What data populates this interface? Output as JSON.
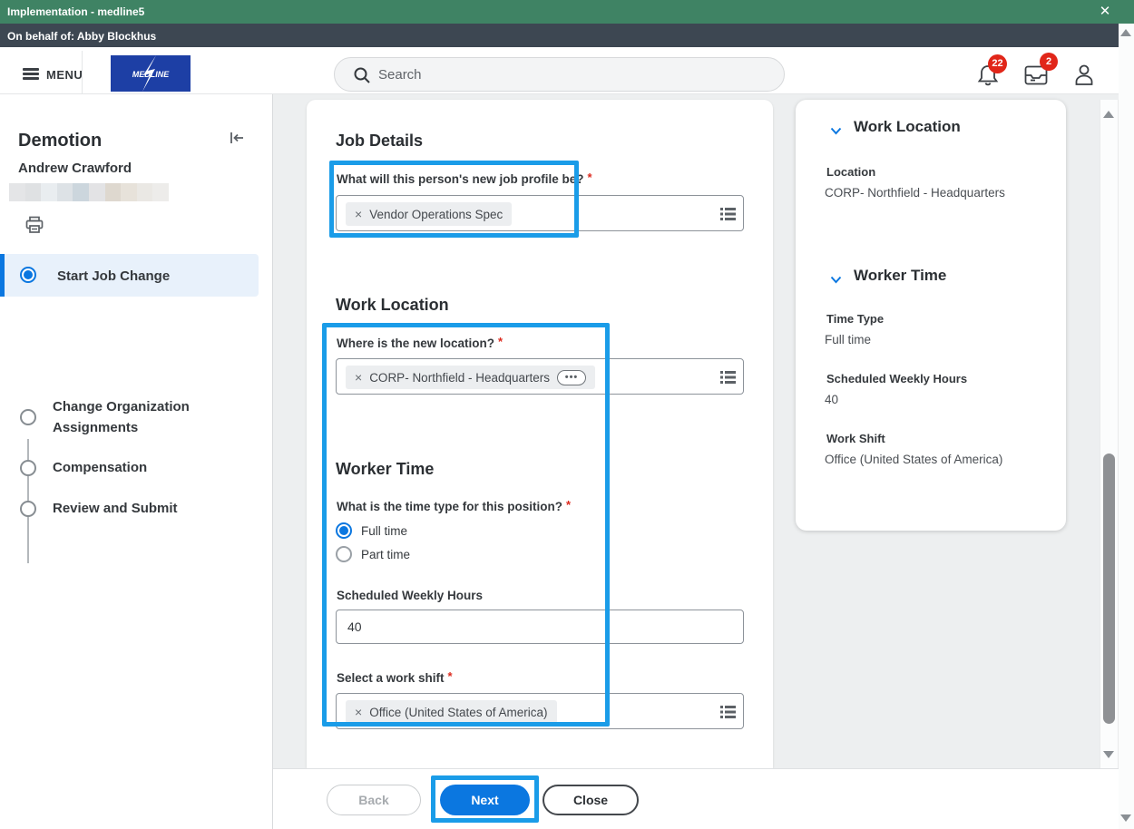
{
  "banner": {
    "title": "Implementation - medline5"
  },
  "proxy_bar": {
    "text": "On behalf of: Abby Blockhus"
  },
  "header": {
    "menu_label": "MENU",
    "logo_text": "MEDLINE",
    "search_placeholder": "Search",
    "notifications_badge": "22",
    "inbox_badge": "2"
  },
  "sidebar": {
    "title": "Demotion",
    "person_name": "Andrew Crawford",
    "steps": [
      {
        "label": "Start Job Change",
        "state": "current"
      },
      {
        "label": "Change Organization Assignments",
        "state": "upcoming"
      },
      {
        "label": "Compensation",
        "state": "upcoming"
      },
      {
        "label": "Review and Submit",
        "state": "upcoming"
      }
    ]
  },
  "form": {
    "required_marker": "*",
    "job_details": {
      "heading": "Job Details",
      "profile_question": "What will this person's new job profile be?",
      "profile_value": "Vendor Operations Spec"
    },
    "work_location": {
      "heading": "Work Location",
      "location_question": "Where is the new location?",
      "location_value": "CORP- Northfield - Headquarters"
    },
    "worker_time": {
      "heading": "Worker Time",
      "time_type_question": "What is the time type for this position?",
      "options": [
        {
          "label": "Full time",
          "selected": true
        },
        {
          "label": "Part time",
          "selected": false
        }
      ],
      "hours_label": "Scheduled Weekly Hours",
      "hours_value": "40",
      "shift_label": "Select a work shift",
      "shift_value": "Office (United States of America)"
    }
  },
  "summary_panel": {
    "work_location": {
      "heading": "Work Location",
      "fields": [
        {
          "label": "Location",
          "value": "CORP- Northfield - Headquarters"
        }
      ]
    },
    "worker_time": {
      "heading": "Worker Time",
      "fields": [
        {
          "label": "Time Type",
          "value": "Full time"
        },
        {
          "label": "Scheduled Weekly Hours",
          "value": "40"
        },
        {
          "label": "Work Shift",
          "value": "Office (United States of America)"
        }
      ]
    }
  },
  "footer": {
    "back_label": "Back",
    "next_label": "Next",
    "close_label": "Close"
  },
  "colors": {
    "accent_blue": "#0b77e0",
    "highlight_blue": "#1a9ce8",
    "banner_green": "#3f8364",
    "proxy_dark": "#3d4752",
    "badge_red": "#e12619"
  }
}
